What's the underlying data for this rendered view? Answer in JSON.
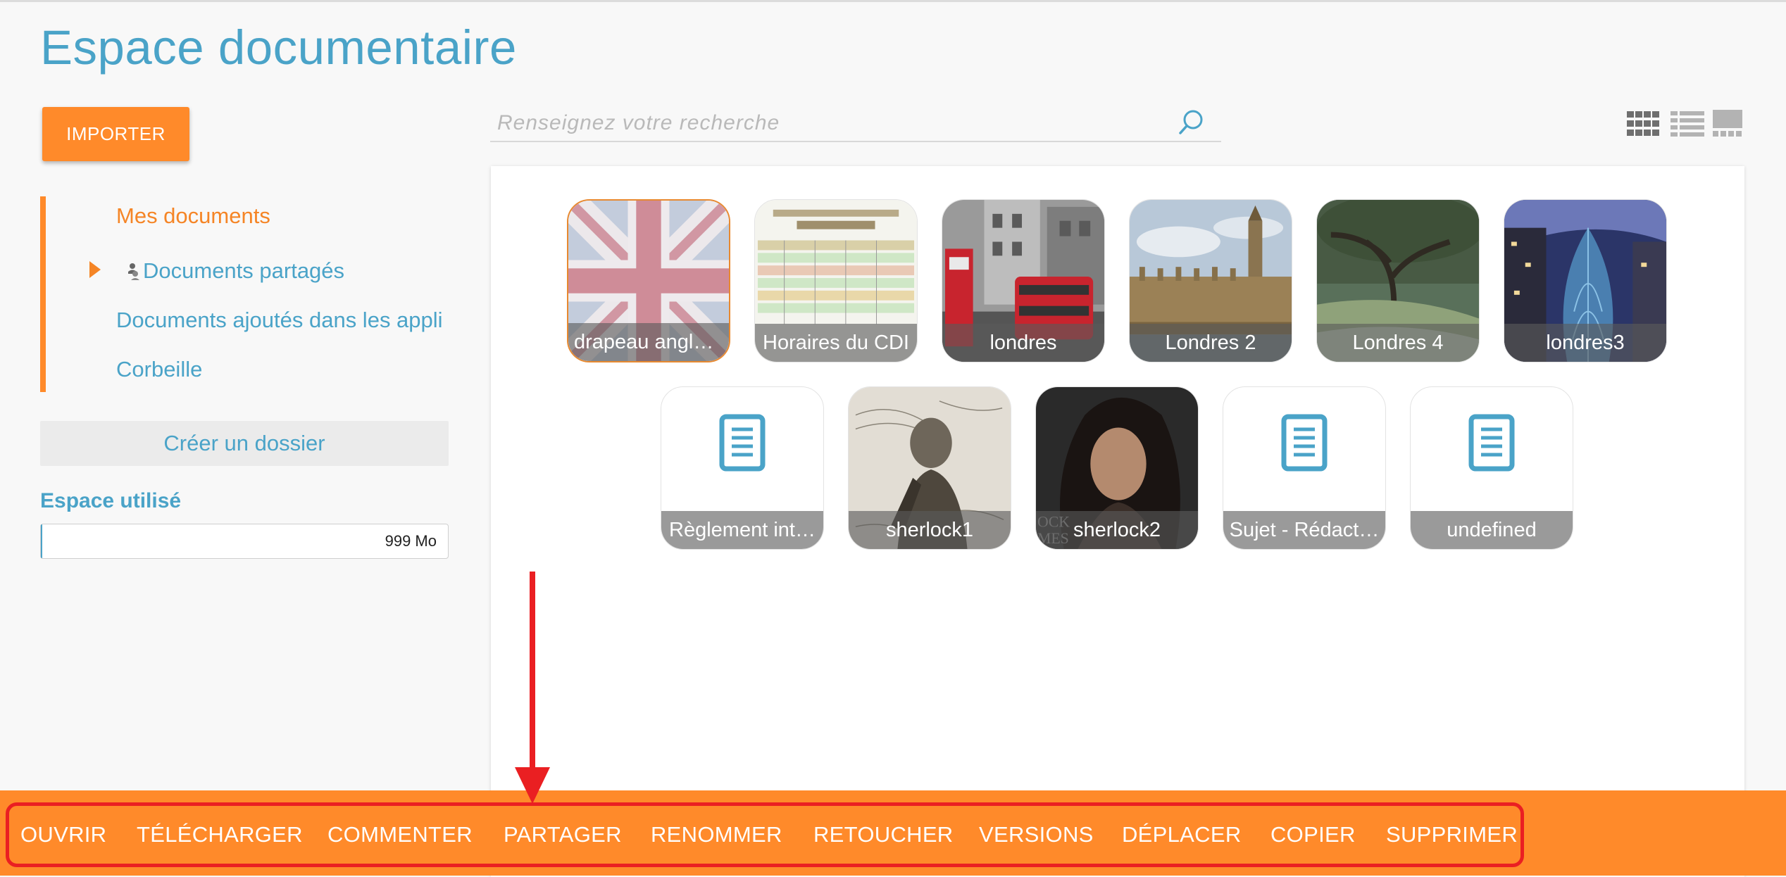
{
  "header": {
    "title": "Espace documentaire"
  },
  "sidebar": {
    "import_label": "IMPORTER",
    "tree": {
      "mine": "Mes documents",
      "shared": "Documents partagés",
      "apps": "Documents ajoutés dans les appli",
      "trash": "Corbeille"
    },
    "create_folder_label": "Créer un dossier",
    "space_used_label": "Espace utilisé",
    "space_used_value": "999 Mo",
    "space_used_fraction": 0.004
  },
  "search": {
    "placeholder": "Renseignez votre recherche",
    "value": ""
  },
  "view_modes": [
    "grid-view-icon",
    "list-view-icon",
    "carousel-view-icon"
  ],
  "files": [
    {
      "label": "drapeau angla…",
      "kind": "image",
      "image": "uk-flag",
      "selected": true
    },
    {
      "label": "Horaires du CDI",
      "kind": "image",
      "image": "schedule-sheet"
    },
    {
      "label": "londres",
      "kind": "image",
      "image": "london-phone-box-bus"
    },
    {
      "label": "Londres 2",
      "kind": "image",
      "image": "westminster-palace"
    },
    {
      "label": "Londres 4",
      "kind": "image",
      "image": "tree-riverbank"
    },
    {
      "label": "londres3",
      "kind": "image",
      "image": "gherkin-tower"
    },
    {
      "label": "Règlement int…",
      "kind": "document",
      "icon": "document-icon"
    },
    {
      "label": "sherlock1",
      "kind": "image",
      "image": "sherlock-engraving"
    },
    {
      "label": "sherlock2",
      "kind": "image",
      "image": "sherlock-movie-poster"
    },
    {
      "label": "Sujet - Rédact…",
      "kind": "document",
      "icon": "document-icon"
    },
    {
      "label": "undefined",
      "kind": "document",
      "icon": "document-icon"
    }
  ],
  "actions": [
    "OUVRIR",
    "TÉLÉCHARGER",
    "COMMENTER",
    "PARTAGER",
    "RENOMMER",
    "RETOUCHER",
    "VERSIONS",
    "DÉPLACER",
    "COPIER",
    "SUPPRIMER"
  ],
  "colors": {
    "accent": "#ff8a2a",
    "link": "#4aa3c8",
    "highlight": "#ea1f22"
  }
}
